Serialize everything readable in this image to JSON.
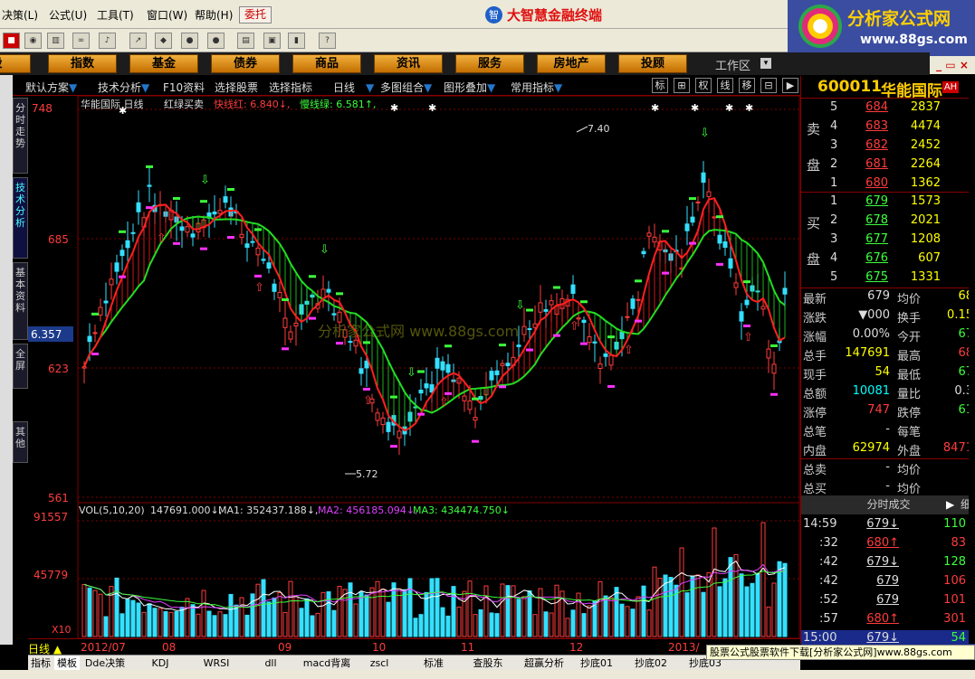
{
  "menu": [
    "决策(L)",
    "公式(U)",
    "工具(T)",
    "窗口(W)",
    "帮助(H)"
  ],
  "wt_button": "委托",
  "brand_title": "大智慧金融终端",
  "logo": {
    "title": "分析家公式网",
    "url": "www.88gs.com"
  },
  "categories": [
    "股",
    "指数",
    "基金",
    "债券",
    "商品",
    "资讯",
    "服务",
    "房地产",
    "投顾"
  ],
  "workarea": "工作区",
  "left_tabs": [
    "分时走势",
    "技术分析",
    "基本资料",
    "全屏",
    "其他"
  ],
  "ctrl": {
    "items": [
      "默认方案",
      "技术分析",
      "F10资料",
      "选择股票",
      "选择指标",
      "日线",
      "多图组合",
      "图形叠加",
      "常用指标"
    ],
    "tools": [
      "标",
      "⊞",
      "权",
      "线",
      "移",
      "⊟",
      "▶"
    ]
  },
  "chart_header": {
    "name": "华能国际 日线",
    "indicator": "红绿买卖",
    "fast_label": "快线红: 6.840↓,",
    "slow_label": "慢线绿: 6.581↑,"
  },
  "price_axis": {
    "labels": [
      "748",
      "685",
      "623",
      "561"
    ],
    "cursor": "6.357"
  },
  "annotations": {
    "high": "7.40",
    "low": "5.72"
  },
  "watermark": "分析家公式网 www.88gs.com",
  "vol_header": {
    "label": "VOL(5,10,20)",
    "value": "147691.000↓,",
    "ma1": "MA1: 352437.188↓,",
    "ma2": "MA2: 456185.094↓,",
    "ma3": "MA3: 434474.750↓"
  },
  "vol_axis": {
    "labels": [
      "91557",
      "45779"
    ],
    "unit": "X10"
  },
  "bottom_dates": {
    "label": "日线",
    "months": [
      "2012/07",
      "08",
      "09",
      "10",
      "11",
      "12",
      "2013/"
    ]
  },
  "bottom_tabs": [
    "指标",
    "模板",
    "Dde决策",
    "KDJ",
    "WRSI",
    "dll",
    "macd背离",
    "zscl",
    "标准",
    "查股东",
    "超赢分析",
    "抄底01",
    "抄底02",
    "抄底03"
  ],
  "ad": "股票公式股票软件下载[分析家公式网]www.88gs.com",
  "quote": {
    "code": "600011",
    "name": "华能国际",
    "badge": "AH",
    "sell_label": [
      "卖",
      "盘"
    ],
    "buy_label": [
      "买",
      "盘"
    ],
    "sell": [
      [
        "5",
        "684",
        "2837"
      ],
      [
        "4",
        "683",
        "4474"
      ],
      [
        "3",
        "682",
        "2452"
      ],
      [
        "2",
        "681",
        "2264"
      ],
      [
        "1",
        "680",
        "1362"
      ]
    ],
    "buy": [
      [
        "1",
        "679",
        "1573"
      ],
      [
        "2",
        "678",
        "2021"
      ],
      [
        "3",
        "677",
        "1208"
      ],
      [
        "4",
        "676",
        "607"
      ],
      [
        "5",
        "675",
        "1331"
      ]
    ],
    "stats": [
      [
        "最新",
        "679",
        "均价",
        "68"
      ],
      [
        "涨跌",
        "▼000",
        "换手",
        "0.15"
      ],
      [
        "涨幅",
        "0.00%",
        "今开",
        "67"
      ],
      [
        "总手",
        "147691",
        "最高",
        "68"
      ],
      [
        "现手",
        "54",
        "最低",
        "67"
      ],
      [
        "总额",
        "10081",
        "量比",
        "0.3"
      ],
      [
        "涨停",
        "747",
        "跌停",
        "61"
      ],
      [
        "总笔",
        "-",
        "每笔",
        ""
      ],
      [
        "内盘",
        "62974",
        "外盘",
        "8471"
      ]
    ],
    "extra": [
      [
        "总卖",
        "-",
        "均价",
        ""
      ],
      [
        "总买",
        "-",
        "均价",
        ""
      ]
    ],
    "ticks_header": "分时成交",
    "ticks_more": "细",
    "ticks": [
      [
        "14:59",
        "679↓",
        "110"
      ],
      [
        ":32",
        "680↑",
        "83"
      ],
      [
        ":42",
        "679↓",
        "128"
      ],
      [
        ":42",
        "679",
        "106"
      ],
      [
        ":52",
        "679",
        "101"
      ],
      [
        ":57",
        "680↑",
        "301"
      ],
      [
        "15:00",
        "679↓",
        "54"
      ]
    ]
  },
  "colors": {
    "up": "#ff3c3c",
    "down": "#33e0ff",
    "fast": "#ff2020",
    "slow": "#22dd22",
    "grid": "#800000"
  }
}
